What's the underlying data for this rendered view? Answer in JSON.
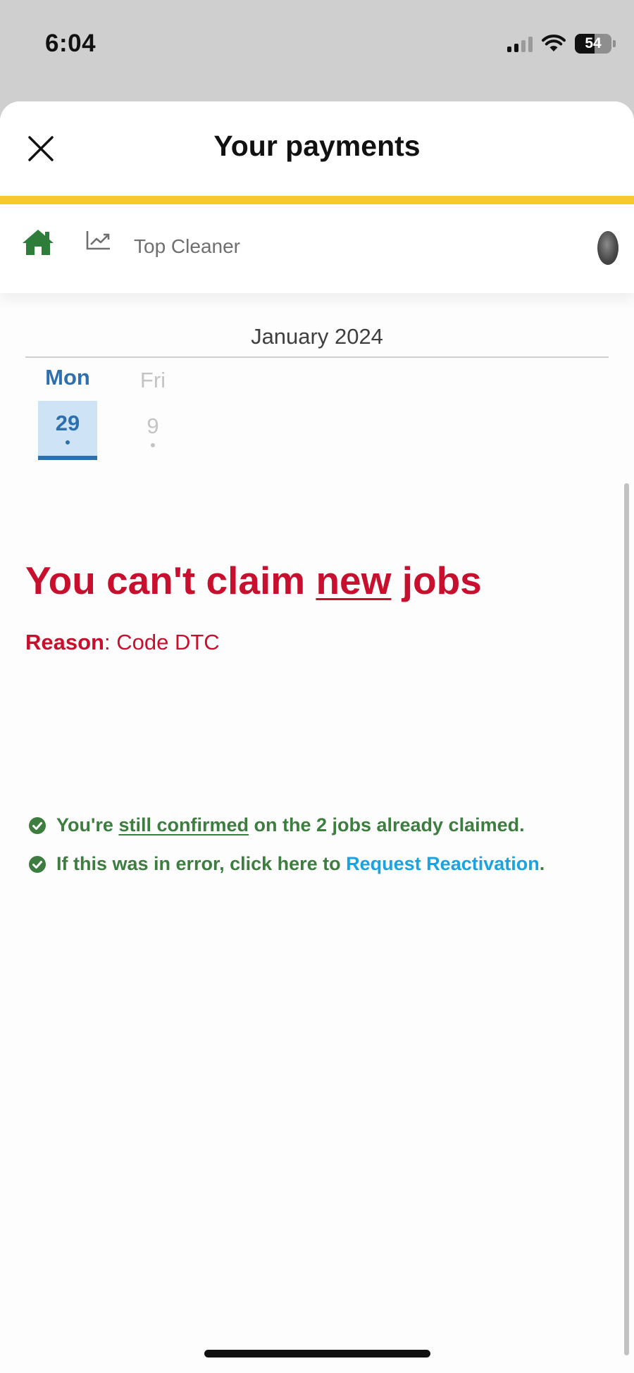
{
  "status_bar": {
    "time": "6:04",
    "battery_level": "54",
    "icons": [
      "signal-icon",
      "wifi-icon",
      "battery-icon"
    ]
  },
  "header": {
    "title": "Your payments",
    "close_icon": "close-icon",
    "accent_color": "#f6ca2c"
  },
  "nav": {
    "home_icon": "home-icon",
    "chart_icon": "trending-chart-icon",
    "label": "Top Cleaner",
    "avatar": "avatar"
  },
  "calendar": {
    "month": "January 2024",
    "days": [
      {
        "weekday": "Mon",
        "day": "29",
        "selected": true
      },
      {
        "weekday": "Fri",
        "day": "9",
        "selected": false
      }
    ]
  },
  "status": {
    "title_prefix": "You can't claim ",
    "title_emphasis": "new",
    "title_suffix": " jobs",
    "reason_label": "Reason",
    "reason_sep": ": ",
    "reason_value": "Code DTC",
    "notes": [
      {
        "prefix": "You're ",
        "emphasis": "still confirmed",
        "suffix": " on the 2 jobs already claimed."
      },
      {
        "prefix": "If this was in error, click here to ",
        "link": "Request Reactivation",
        "suffix": "."
      }
    ]
  },
  "colors": {
    "error": "#c8102e",
    "success": "#3d7d3f",
    "link": "#1aa3e0",
    "selected_day": "#2e6fad",
    "home_icon": "#2f7d3a"
  }
}
